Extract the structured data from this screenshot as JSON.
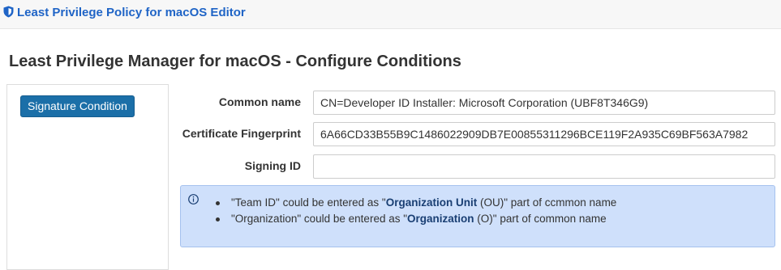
{
  "header": {
    "app_title": "Least Privilege Policy for macOS Editor",
    "icon": "shield-icon"
  },
  "page": {
    "title": "Least Privilege Manager for macOS - Configure Conditions"
  },
  "sidebar": {
    "button_label": "Signature Condition"
  },
  "form": {
    "common_name": {
      "label": "Common name",
      "value": "CN=Developer ID Installer: Microsoft Corporation (UBF8T346G9)"
    },
    "certificate_fingerprint": {
      "label": "Certificate Fingerprint",
      "value": "6A66CD33B55B9C1486022909DB7E00855311296BCE119F2A935C69BF563A7982"
    },
    "signing_id": {
      "label": "Signing ID",
      "value": ""
    }
  },
  "info": {
    "icon": "info-icon",
    "items": [
      {
        "pre": "\"Team ID\" could be entered as \"",
        "bold": "Organization Unit",
        "post": " (OU)\" part of ccmmon name"
      },
      {
        "pre": "\"Organization\" could be entered as \"",
        "bold": "Organization",
        "post": " (O)\" part of common name"
      }
    ]
  },
  "colors": {
    "brand_blue": "#1f64c6",
    "button_blue": "#1b6fa8",
    "info_background": "#cfe0fb",
    "info_border": "#a6c2ee"
  }
}
